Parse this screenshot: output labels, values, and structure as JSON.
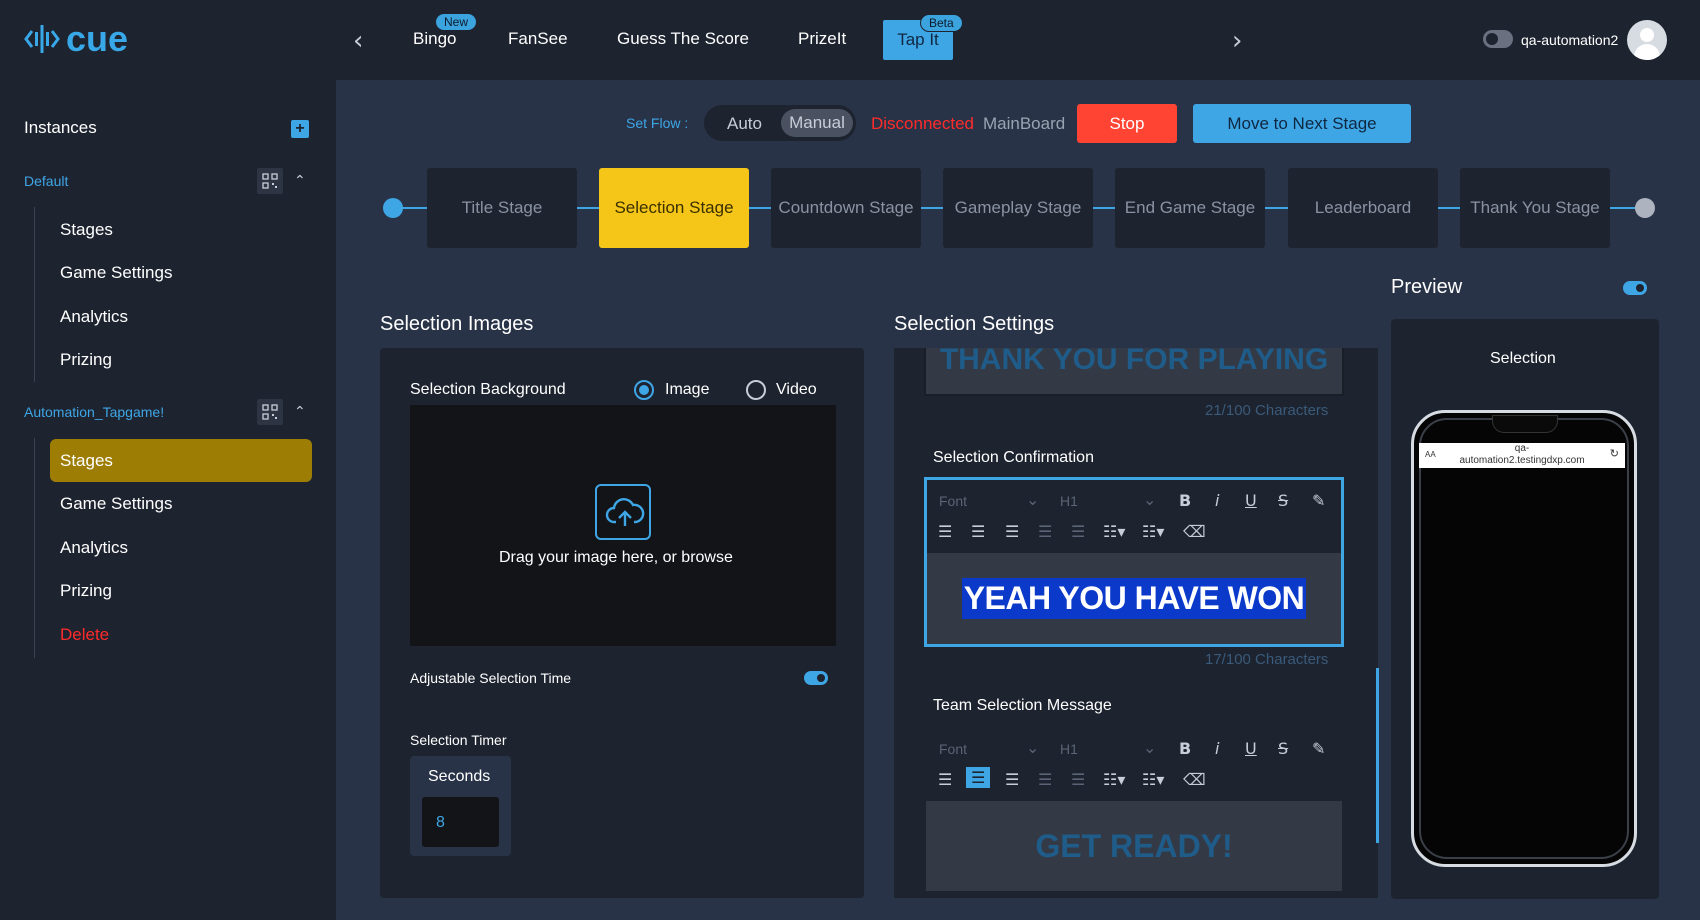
{
  "app": {
    "logo_text": "cue",
    "username": "qa-automation2"
  },
  "top_nav": {
    "prev_icon": "chevron-left-icon",
    "next_icon": "chevron-right-icon",
    "items": [
      {
        "label": "Bingo",
        "badge": "New"
      },
      {
        "label": "FanSee"
      },
      {
        "label": "Guess The Score"
      },
      {
        "label": "PrizeIt"
      },
      {
        "label": "Tap It",
        "badge": "Beta",
        "active": true
      }
    ]
  },
  "sidebar": {
    "heading": "Instances",
    "add_icon": "plus-icon",
    "groups": [
      {
        "title": "Default",
        "items": [
          "Stages",
          "Game Settings",
          "Analytics",
          "Prizing"
        ]
      },
      {
        "title": "Automation_Tapgame!",
        "items": [
          "Stages",
          "Game Settings",
          "Analytics",
          "Prizing"
        ],
        "active_item": "Stages",
        "delete_label": "Delete"
      }
    ]
  },
  "controls": {
    "set_flow_label": "Set Flow :",
    "flow_options": [
      "Auto",
      "Manual"
    ],
    "flow_selected": "Manual",
    "connection_status": "Disconnected",
    "board_name": "MainBoard",
    "stop_label": "Stop",
    "next_stage_label": "Move to Next Stage"
  },
  "stages": {
    "items": [
      "Title Stage",
      "Selection Stage",
      "Countdown Stage",
      "Gameplay Stage",
      "End Game Stage",
      "Leaderboard",
      "Thank You Stage"
    ],
    "active": "Selection Stage"
  },
  "selection_images": {
    "title": "Selection Images",
    "background_label": "Selection Background",
    "media_options": [
      "Image",
      "Video"
    ],
    "media_selected": "Image",
    "dropzone_text": "Drag your image here, or browse",
    "adjustable_time_label": "Adjustable Selection Time",
    "adjustable_time_enabled": true,
    "timer_label": "Selection Timer",
    "timer_unit": "Seconds",
    "timer_value": "8"
  },
  "selection_settings": {
    "title": "Selection Settings",
    "prev_field_text": "THANK YOU FOR PLAYING",
    "prev_field_chars": "21/100 Characters",
    "confirmation": {
      "label": "Selection Confirmation",
      "font_placeholder": "Font",
      "heading": "H1",
      "text": "YEAH YOU HAVE WON",
      "chars": "17/100 Characters"
    },
    "team_message": {
      "label": "Team Selection Message",
      "font_placeholder": "Font",
      "heading": "H1",
      "text": "GET READY!"
    },
    "toolbar_icons": [
      "bold-icon",
      "italic-icon",
      "underline-icon",
      "strikethrough-icon",
      "highlight-icon",
      "align-left-icon",
      "align-center-icon",
      "align-right-icon",
      "indent-decrease-icon",
      "indent-increase-icon",
      "ordered-list-icon",
      "bullet-list-icon",
      "eraser-icon"
    ]
  },
  "preview": {
    "title": "Preview",
    "enabled": true,
    "screen_label": "Selection",
    "url_text_1": "qa-",
    "url_text_2": "automation2.testingdxp.com",
    "url_aa": "AA"
  },
  "colors": {
    "accent": "#3fa6e6",
    "active_stage": "#f5c518",
    "danger": "#ff4433",
    "sidebar_active": "#9e7d05"
  }
}
